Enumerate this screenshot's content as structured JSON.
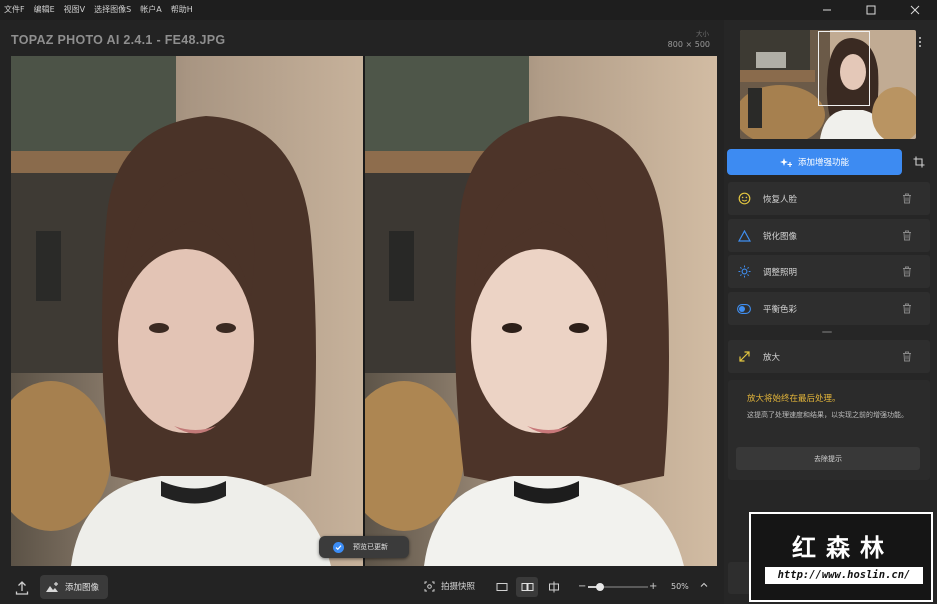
{
  "menubar": {
    "items": [
      "文件F",
      "编辑E",
      "视图V",
      "选择图像S",
      "帐户A",
      "帮助H"
    ]
  },
  "window": {
    "title": "TOPAZ PHOTO AI 2.4.1 - FE48.JPG",
    "size_label": "大小",
    "size_value": "800 × 500"
  },
  "preview": {
    "toast": "预览已更新"
  },
  "bottombar": {
    "add_image": "添加图像",
    "snapshot": "拍摄快照",
    "zoom": "50%",
    "zoom_fraction": 0.2
  },
  "sidebar": {
    "enhance_button": "添加增强功能",
    "enhancements": [
      {
        "label": "恢复人脸",
        "icon": "face-icon",
        "color": "#e2c540"
      },
      {
        "label": "锐化图像",
        "icon": "triangle-icon",
        "color": "#3f8ef0"
      },
      {
        "label": "调整照明",
        "icon": "sun-icon",
        "color": "#3f8ef0"
      },
      {
        "label": "平衡色彩",
        "icon": "color-balance-icon",
        "color": "#3f8ef0"
      }
    ],
    "upscale": {
      "label": "放大",
      "icon": "expand-icon",
      "color": "#e2c540"
    },
    "note": {
      "title": "放大将始终在最后处理。",
      "description": "这提高了处理速度和结果，以实现之前的增强功能。",
      "dismiss": "去除提示"
    }
  },
  "watermark": {
    "title": "红森林",
    "url": "http://www.hoslin.cn/"
  },
  "colors": {
    "accent": "#3d8bf2",
    "warning": "#e3b53a",
    "background": "#232323",
    "panel": "#2e2e2e"
  }
}
